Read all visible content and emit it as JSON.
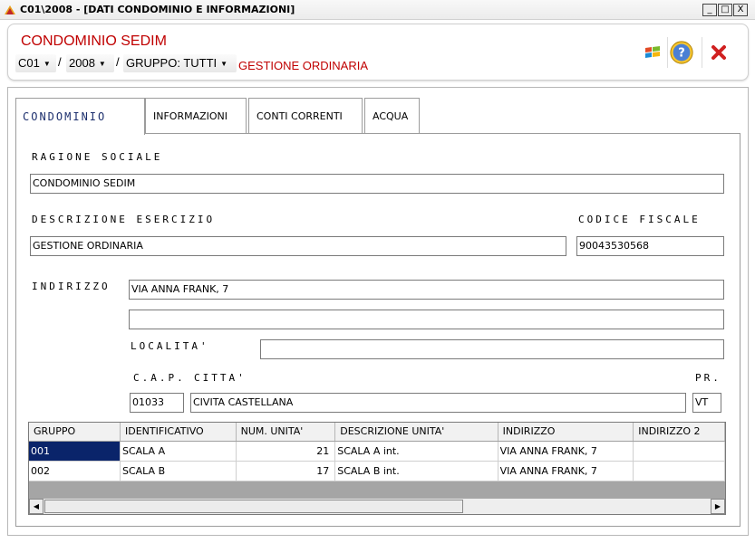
{
  "window": {
    "title": "C01\\2008 - [DATI CONDOMINIO E INFORMAZIONI]",
    "minimize": "_",
    "maximize": "□",
    "close": "X"
  },
  "header": {
    "company_name": "CONDOMINIO SEDIM",
    "condominio_code": "C01",
    "year": "2008",
    "gruppo": "GRUPPO: TUTTI",
    "separator": "/",
    "gestione": "GESTIONE ORDINARIA",
    "icons": {
      "windows": "windows-logo-icon",
      "help": "help-icon",
      "close": "close-icon"
    }
  },
  "tabs": [
    {
      "label": "CONDOMINIO",
      "active": true
    },
    {
      "label": "INFORMAZIONI",
      "active": false
    },
    {
      "label": "CONTI CORRENTI",
      "active": false
    },
    {
      "label": "ACQUA",
      "active": false
    }
  ],
  "form": {
    "ragione_sociale_label": "RAGIONE SOCIALE",
    "ragione_sociale": "CONDOMINIO SEDIM",
    "descrizione_label": "DESCRIZIONE  ESERCIZIO",
    "descrizione": "GESTIONE ORDINARIA",
    "codice_fiscale_label": "CODICE  FISCALE",
    "codice_fiscale": "90043530568",
    "indirizzo_label": "INDIRIZZO",
    "indirizzo_1": "VIA ANNA FRANK, 7",
    "indirizzo_2": "",
    "localita_label": "LOCALITA'",
    "localita": "",
    "cap_label": "C.A.P.",
    "cap": "01033",
    "citta_label": "CITTA'",
    "citta": "CIVITA CASTELLANA",
    "pr_label": "PR.",
    "pr": "VT"
  },
  "grid": {
    "columns": [
      "GRUPPO",
      "IDENTIFICATIVO",
      "NUM. UNITA'",
      "DESCRIZIONE UNITA'",
      "INDIRIZZO",
      "INDIRIZZO 2"
    ],
    "rows": [
      [
        "001",
        "SCALA A",
        "21",
        "SCALA A int.",
        "VIA ANNA FRANK, 7",
        ""
      ],
      [
        "002",
        "SCALA B",
        "17",
        "SCALA B int.",
        "VIA ANNA FRANK, 7",
        ""
      ]
    ],
    "scroll_left": "◀",
    "scroll_right": "▶"
  },
  "colors": {
    "brand_red": "#c00000",
    "active_tab_text": "#1c2f6d",
    "selection": "#0a246a"
  }
}
